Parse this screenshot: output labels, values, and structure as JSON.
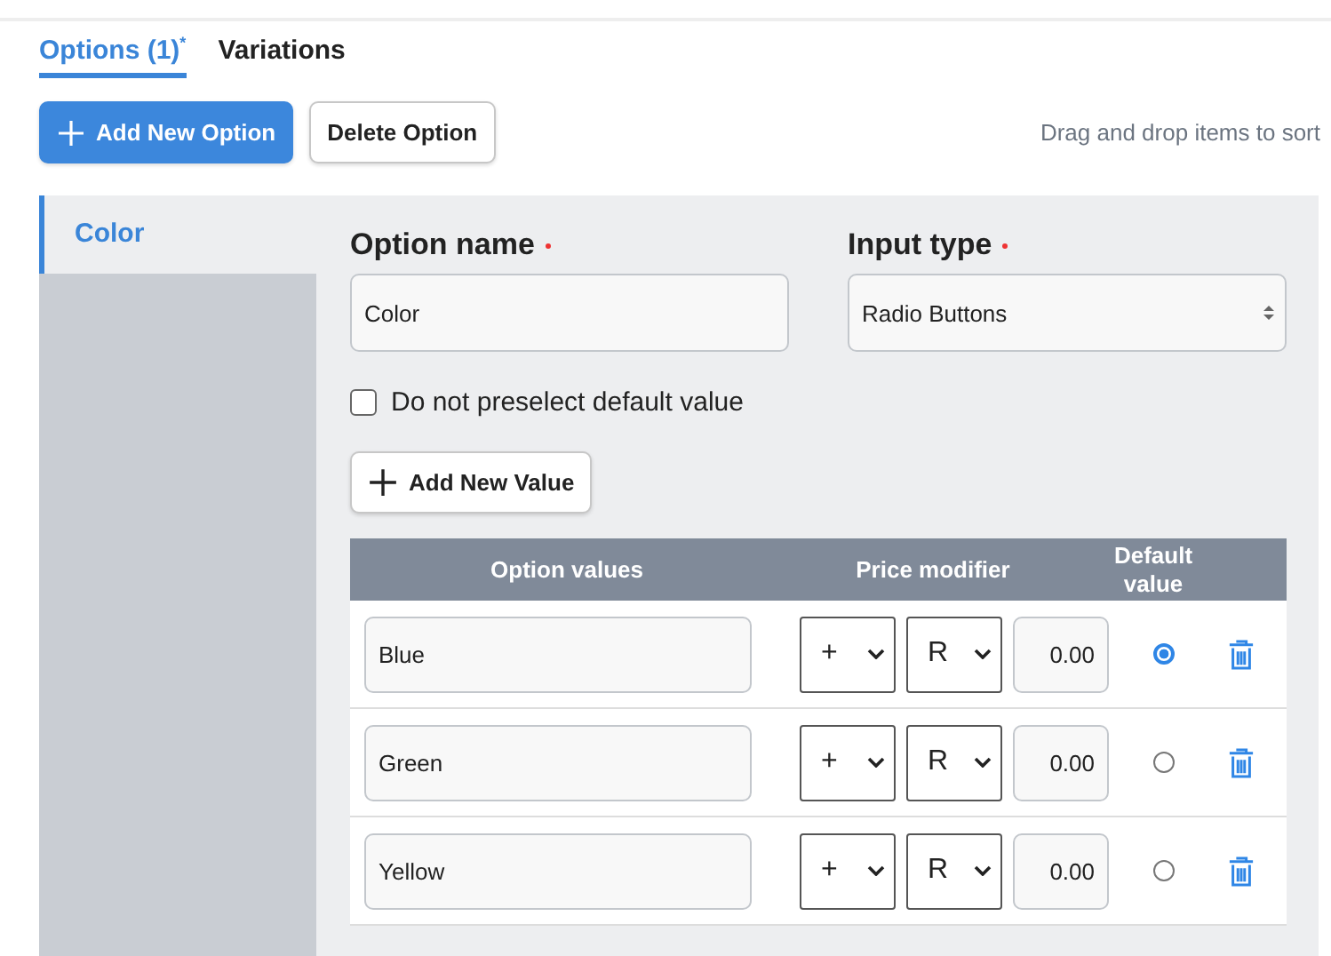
{
  "tabs": [
    {
      "label": "Options (1)$^{*}$",
      "selected": true
    },
    {
      "label": "Variations",
      "selected": false
    }
  ],
  "toolbar": {
    "add_button": "Add New Option",
    "delete_button": "Delete Option",
    "hint": "Drag and drop items to sort"
  },
  "sidebar": {
    "items": [
      {
        "label": "Color",
        "selected": true
      }
    ]
  },
  "form": {
    "option_name": {
      "label": "Option name",
      "required": true,
      "value": "Color"
    },
    "input_type": {
      "label": "Input type",
      "required": true,
      "value": "Radio Buttons"
    },
    "no_preselect": {
      "label": "Do not preselect default value",
      "checked": false
    },
    "add_value_button": "Add New Value"
  },
  "table": {
    "columns": [
      "Option values",
      "Price modifier",
      "Default value"
    ],
    "rows": [
      {
        "value": "Blue",
        "sign": "+",
        "currency": "R",
        "amount": "0.00",
        "selected": true
      },
      {
        "value": "Green",
        "sign": "+",
        "currency": "R",
        "amount": "0.00",
        "selected": false
      },
      {
        "value": "Yellow",
        "sign": "+",
        "currency": "R",
        "amount": "0.00",
        "selected": false
      }
    ]
  }
}
